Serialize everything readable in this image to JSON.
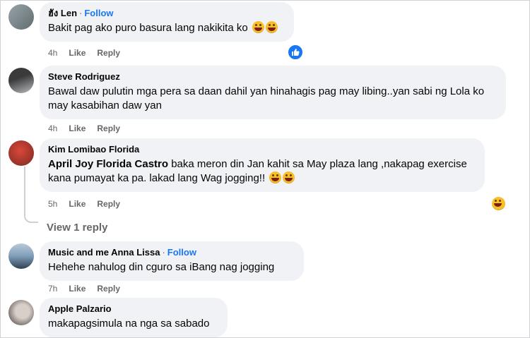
{
  "comments": [
    {
      "author": "ฮัง Len",
      "follow": "Follow",
      "text": "Bakit pag ako puro basura lang nakikita ko",
      "time": "4h",
      "like": "Like",
      "reply": "Reply",
      "avatar_colors": [
        "#9aa3a8",
        "#5f6d70"
      ]
    },
    {
      "author": "Steve Rodriguez",
      "text": "Bawal daw pulutin mga pera sa daan dahil yan hinahagis pag may libing..yan sabi ng Lola ko may kasabihan daw yan",
      "time": "4h",
      "like": "Like",
      "reply": "Reply",
      "avatar_colors": [
        "#3b3b3b",
        "#b9bcbf"
      ]
    },
    {
      "author": "Kim Lomibao Florida",
      "mention": "April Joy Florida Castro",
      "text": " baka meron din Jan kahit sa May plaza lang ,nakapag exercise kana pumayat ka pa. lakad lang Wag jogging!!",
      "time": "5h",
      "like": "Like",
      "reply": "Reply",
      "avatar_colors": [
        "#d9473a",
        "#7a2a22"
      ]
    },
    {
      "author": "Music and me Anna Lissa",
      "follow": "Follow",
      "text": "Hehehe nahulog din cguro sa iBang nag jogging",
      "time": "7h",
      "like": "Like",
      "reply": "Reply",
      "avatar_colors": [
        "#7f9db8",
        "#2f3f52"
      ]
    },
    {
      "author": "Apple Palzario",
      "text": "makapagsimula na nga sa sabado",
      "avatar_colors": [
        "#d8cfc8",
        "#3a3030"
      ]
    }
  ],
  "view_reply": "View 1 reply",
  "colors": {
    "accent": "#1877f2",
    "bubble": "#f0f2f5",
    "muted": "#65676b"
  },
  "icons": {
    "laugh": "laughing-face-emoji",
    "like_reaction": "thumbs-up-icon"
  }
}
